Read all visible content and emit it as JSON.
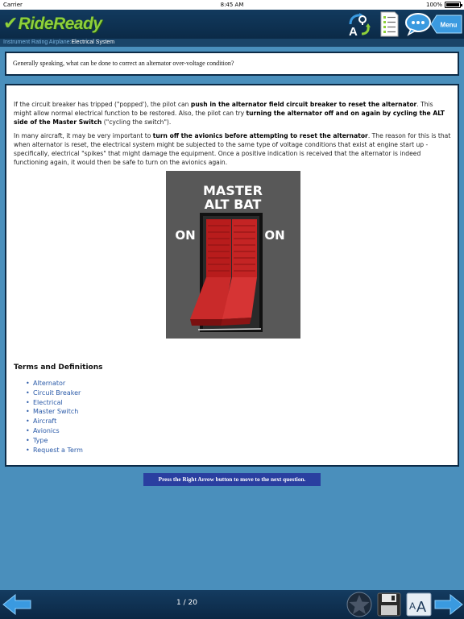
{
  "status_bar": {
    "carrier": "Carrier",
    "time": "8:45 AM",
    "battery": "100%"
  },
  "header": {
    "logo_text": "RideReady",
    "logo_check_icon": "check-icon",
    "toolbar_icons": [
      "glossary-icon",
      "checklist-icon",
      "chat-icon"
    ],
    "menu_label": "Menu"
  },
  "breadcrumb": {
    "parent": "Instrument Rating Airplane",
    "current": "Electrical System"
  },
  "question": "Generally speaking, what can be done to correct an alternator over-voltage condition?",
  "answer": {
    "p1": {
      "a": "If the circuit breaker has tripped (\"popped'), the pilot can ",
      "b": "push in the alternator field circuit breaker to reset the alternator",
      "c": ". This might allow normal electrical function to be restored. Also, the pilot can try ",
      "d": "turning the alternator off and on again by cycling the ALT side of the Master Switch",
      "e": " (\"cycling the switch\")."
    },
    "p2": {
      "a": "In many aircraft, it may be very important to ",
      "b": "turn off the avionics before attempting to reset the alternator",
      "c": ". The reason for this is that when alternator is reset, the electrical system might be subjected to the same type of voltage conditions that exist at engine start up - specifically, electrical \"spikes\" that might damage the equipment. Once a positive indication is received that the alternator is indeed functioning again, it would then be safe to turn on the avionics again."
    },
    "switch_image": {
      "line1": "MASTER",
      "line2": "ALT BAT",
      "left_label": "ON",
      "right_label": "ON"
    }
  },
  "terms": {
    "title": "Terms and Definitions",
    "items": [
      "Alternator",
      "Circuit Breaker",
      "Electrical",
      "Master Switch",
      "Aircraft",
      "Avionics",
      "Type",
      "Request a Term"
    ]
  },
  "hint": "Press the Right Arrow button to move to the next question.",
  "footer": {
    "page_counter": "1 / 20",
    "icons": [
      "arrow-left-icon",
      "star-icon",
      "save-icon",
      "font-size-icon",
      "arrow-right-icon"
    ]
  },
  "colors": {
    "background": "#4a8fbc",
    "header": "#0f3355",
    "accent_green": "#8ed03a",
    "link": "#2a5aa8",
    "hint_bar": "#2a3fa0"
  }
}
